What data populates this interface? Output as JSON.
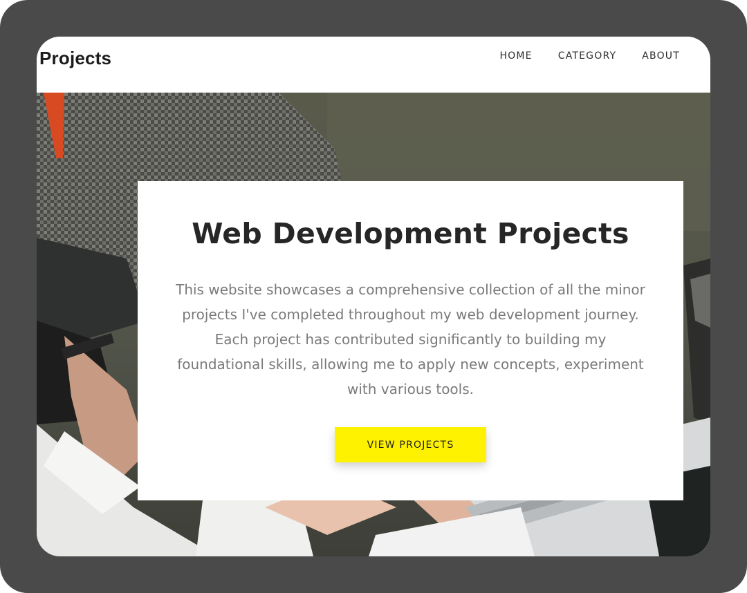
{
  "brand": {
    "name": "Projects"
  },
  "nav": {
    "items": [
      "HOME",
      "CATEGORY",
      "ABOUT"
    ]
  },
  "hero": {
    "title": "Web Development Projects",
    "description": "This website showcases a comprehensive collection of all the minor projects I've completed throughout my web development journey. Each project has contributed significantly to building my foundational skills, allowing me to apply new concepts, experiment with various tools.",
    "cta_label": "VIEW PROJECTS"
  }
}
